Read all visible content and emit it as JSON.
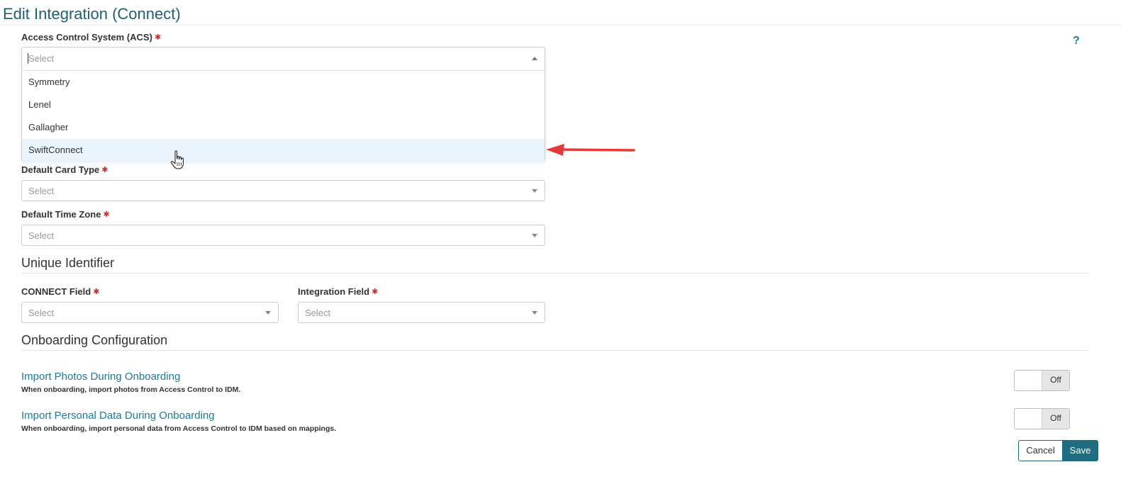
{
  "page": {
    "title": "Edit Integration (Connect)",
    "help_glyph": "?"
  },
  "required_marker": "✱",
  "acs": {
    "label": "Access Control System (ACS)",
    "placeholder": "Select",
    "options": [
      "Symmetry",
      "Lenel",
      "Gallagher",
      "SwiftConnect"
    ],
    "highlighted_option": "SwiftConnect"
  },
  "default_card_type": {
    "label": "Default Card Type",
    "placeholder": "Select"
  },
  "default_time_zone": {
    "label": "Default Time Zone",
    "placeholder": "Select"
  },
  "unique_identifier": {
    "heading": "Unique Identifier",
    "connect_field": {
      "label": "CONNECT Field",
      "placeholder": "Select"
    },
    "integration_field": {
      "label": "Integration Field",
      "placeholder": "Select"
    }
  },
  "onboarding": {
    "heading": "Onboarding Configuration",
    "import_photos": {
      "title": "Import Photos During Onboarding",
      "description": "When onboarding, import photos from Access Control to IDM.",
      "state": "Off"
    },
    "import_personal_data": {
      "title": "Import Personal Data During Onboarding",
      "description": "When onboarding, import personal data from Access Control to IDM based on mappings.",
      "state": "Off"
    }
  },
  "actions": {
    "cancel": "Cancel",
    "save": "Save"
  },
  "colors": {
    "title": "#1f5e73",
    "link_title": "#1f7a93",
    "required": "#c9302c",
    "primary_button": "#1f6d80",
    "highlight_row": "#eaf4fc",
    "annotation_arrow": "#e03c3c"
  }
}
